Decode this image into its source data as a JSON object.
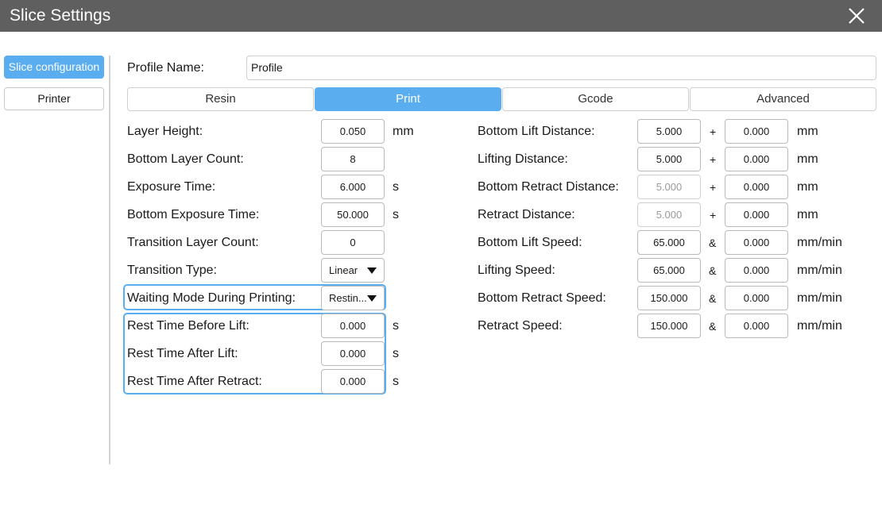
{
  "window": {
    "title": "Slice Settings"
  },
  "sidebar": {
    "items": [
      {
        "label": "Slice configuration"
      },
      {
        "label": "Printer"
      }
    ]
  },
  "profile": {
    "label": "Profile Name:",
    "value": "Profile"
  },
  "tabs": [
    {
      "label": "Resin"
    },
    {
      "label": "Print"
    },
    {
      "label": "Gcode"
    },
    {
      "label": "Advanced"
    }
  ],
  "active_tab": "Print",
  "left_fields": [
    {
      "label": "Layer Height:",
      "value": "0.050",
      "unit": "mm"
    },
    {
      "label": "Bottom Layer Count:",
      "value": "8",
      "unit": ""
    },
    {
      "label": "Exposure Time:",
      "value": "6.000",
      "unit": "s"
    },
    {
      "label": "Bottom Exposure Time:",
      "value": "50.000",
      "unit": "s"
    },
    {
      "label": "Transition Layer Count:",
      "value": "0",
      "unit": ""
    },
    {
      "label": "Transition Type:",
      "value": "Linear",
      "unit": ""
    },
    {
      "label": "Waiting Mode During Printing:",
      "value": "Restin...",
      "unit": ""
    },
    {
      "label": "Rest Time Before Lift:",
      "value": "0.000",
      "unit": "s"
    },
    {
      "label": "Rest Time After Lift:",
      "value": "0.000",
      "unit": "s"
    },
    {
      "label": "Rest Time After Retract:",
      "value": "0.000",
      "unit": "s"
    }
  ],
  "right_fields": [
    {
      "label": "Bottom Lift Distance:",
      "value1": "5.000",
      "op": "+",
      "value2": "0.000",
      "unit": "mm"
    },
    {
      "label": "Lifting Distance:",
      "value1": "5.000",
      "op": "+",
      "value2": "0.000",
      "unit": "mm"
    },
    {
      "label": "Bottom Retract Distance:",
      "value1": "5.000",
      "op": "+",
      "value2": "0.000",
      "unit": "mm"
    },
    {
      "label": "Retract Distance:",
      "value1": "5.000",
      "op": "+",
      "value2": "0.000",
      "unit": "mm"
    },
    {
      "label": "Bottom Lift Speed:",
      "value1": "65.000",
      "op": "&",
      "value2": "0.000",
      "unit": "mm/min"
    },
    {
      "label": "Lifting Speed:",
      "value1": "65.000",
      "op": "&",
      "value2": "0.000",
      "unit": "mm/min"
    },
    {
      "label": "Bottom Retract Speed:",
      "value1": "150.000",
      "op": "&",
      "value2": "0.000",
      "unit": "mm/min"
    },
    {
      "label": "Retract Speed:",
      "value1": "150.000",
      "op": "&",
      "value2": "0.000",
      "unit": "mm/min"
    }
  ],
  "icons": {
    "close": "close-icon",
    "dropdown": "triangle-down-icon"
  },
  "colors": {
    "accent": "#5aaef0",
    "titlebar": "#5f5f5f"
  }
}
